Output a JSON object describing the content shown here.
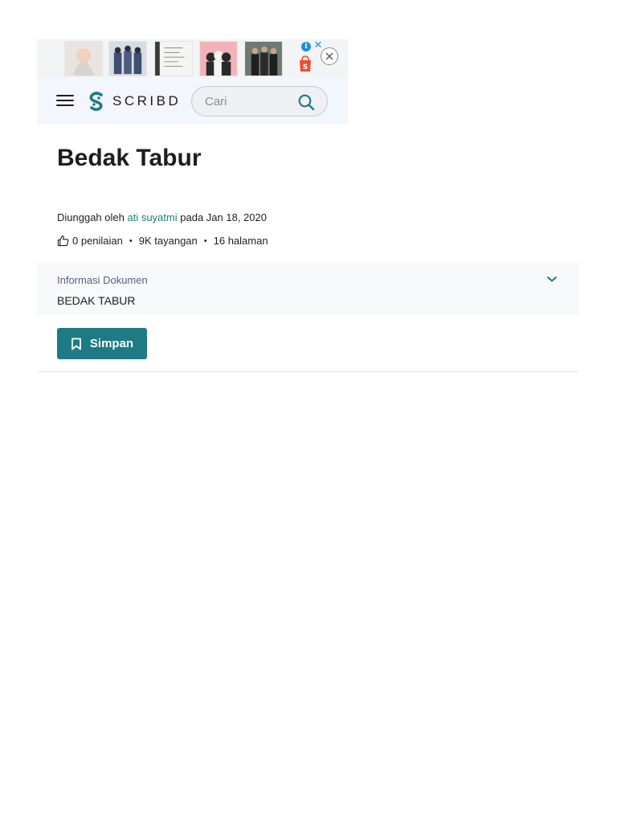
{
  "ad": {
    "images": [
      "ad-photo-1",
      "ad-photo-2",
      "ad-photo-3",
      "ad-photo-4",
      "ad-photo-5"
    ],
    "info_glyph": "i",
    "close_glyph": "✕",
    "brand_icon": "shopee-bag-icon"
  },
  "header": {
    "logo_text": "SCRIBD",
    "search": {
      "placeholder": "Cari",
      "value": ""
    }
  },
  "document": {
    "title": "Bedak Tabur",
    "uploaded_prefix": "Diunggah oleh",
    "author": "ati suyatmi",
    "uploaded_mid": "pada",
    "date": "Jan 18, 2020",
    "ratings": "0 penilaian",
    "views": "9K tayangan",
    "pages": "16 halaman",
    "separator": "•"
  },
  "doc_info": {
    "label": "Informasi Dokumen",
    "value": "BEDAK TABUR"
  },
  "actions": {
    "save_label": "Simpan"
  },
  "colors": {
    "brand": "#1e7b85",
    "header_bg": "#f3f6fd",
    "info_bg": "#f8f9fb"
  }
}
